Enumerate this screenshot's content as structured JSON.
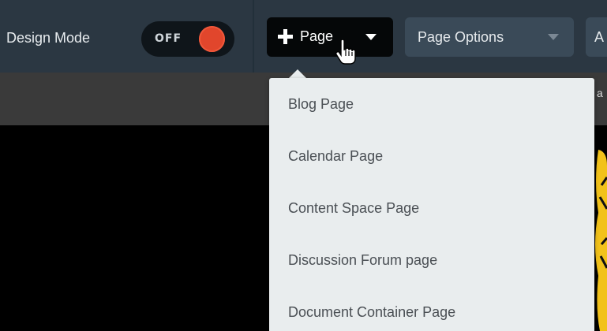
{
  "toolbar": {
    "design_mode_label": "Design Mode",
    "toggle_state": "OFF",
    "toggle_color": "#e1462c",
    "add_page_label": "Page",
    "page_options_label": "Page Options",
    "next_button_label": "A"
  },
  "subbar": {
    "text": "a"
  },
  "page_menu": {
    "items": [
      {
        "label": "Blog Page"
      },
      {
        "label": "Calendar Page"
      },
      {
        "label": "Content Space Page"
      },
      {
        "label": "Discussion Forum page"
      },
      {
        "label": "Document Container Page"
      }
    ]
  },
  "icons": {
    "add": "plus-icon",
    "caret": "caret-down-icon",
    "pointer": "hand-pointer-icon"
  }
}
